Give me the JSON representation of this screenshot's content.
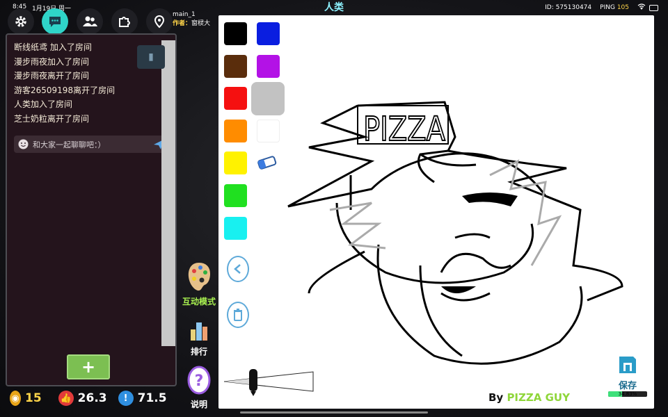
{
  "status": {
    "time": "8:45",
    "date": "1月19日 周一"
  },
  "title": "人类",
  "header": {
    "id": "ID: 575130474",
    "ping_label": "PING",
    "ping": "105"
  },
  "map": {
    "name": "main_1",
    "author_label": "作者：",
    "author": "窗棂大"
  },
  "toolbar": {
    "icons": [
      "gear-icon",
      "chat-icon",
      "users-icon",
      "puzzle-icon",
      "map-pin-icon"
    ]
  },
  "chat": {
    "messages": [
      "断线纸鸢 加入了房间",
      "漫步雨夜加入了房间",
      "漫步雨夜离开了房间",
      "游客26509198离开了房间",
      "人类加入了房间",
      "芝士奶粒离开了房间"
    ],
    "input_placeholder": "和大家一起聊聊吧：）",
    "add_label": "+"
  },
  "stats": {
    "coins": "15",
    "likes": "26.3",
    "reports": "71.5"
  },
  "side_tools": {
    "interactive": "互动模式",
    "rank": "排行",
    "help": "说明"
  },
  "palette": {
    "colors": [
      "#000000",
      "#0a1ee0",
      "#5a2d0c",
      "#b312e6",
      "#f51010",
      "#c2c2c2",
      "#ff8c00",
      "#ffffff",
      "#fff200",
      "#20e020",
      "#18f0f0"
    ],
    "selected": "#c2c2c2"
  },
  "canvas": {
    "drawing_text": "PIZZA",
    "credit_prefix": "By ",
    "credit_name": "PIZZA GUY",
    "save_label": "保存",
    "progress_text": "34.83%",
    "progress": 0.3483
  }
}
